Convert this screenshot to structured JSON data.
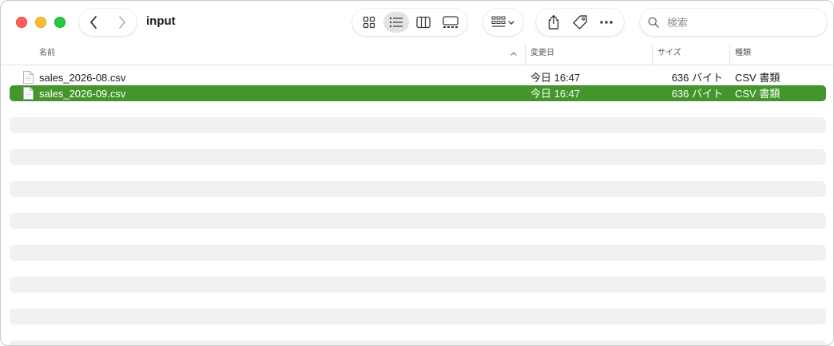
{
  "window": {
    "title": "input"
  },
  "toolbar": {
    "back": "chevron-left-icon",
    "forward": "chevron-right-icon",
    "views": [
      "icon-view",
      "list-view",
      "column-view",
      "gallery-view"
    ],
    "active_view": "list-view",
    "share": "share-icon",
    "tag": "tag-icon",
    "more": "ellipsis-icon"
  },
  "search": {
    "placeholder": "検索",
    "value": ""
  },
  "columns": {
    "name": "名前",
    "date": "変更日",
    "size": "サイズ",
    "kind": "種類"
  },
  "files": [
    {
      "name": "sales_2026-08.csv",
      "date": "今日 16:47",
      "size": "636 バイト",
      "kind": "CSV 書類",
      "selected": false
    },
    {
      "name": "sales_2026-09.csv",
      "date": "今日 16:47",
      "size": "636 バイト",
      "kind": "CSV 書類",
      "selected": true
    }
  ],
  "colors": {
    "selection": "#43952c",
    "close": "#ff5f57",
    "minimize": "#febc2e",
    "zoom": "#28c840"
  }
}
